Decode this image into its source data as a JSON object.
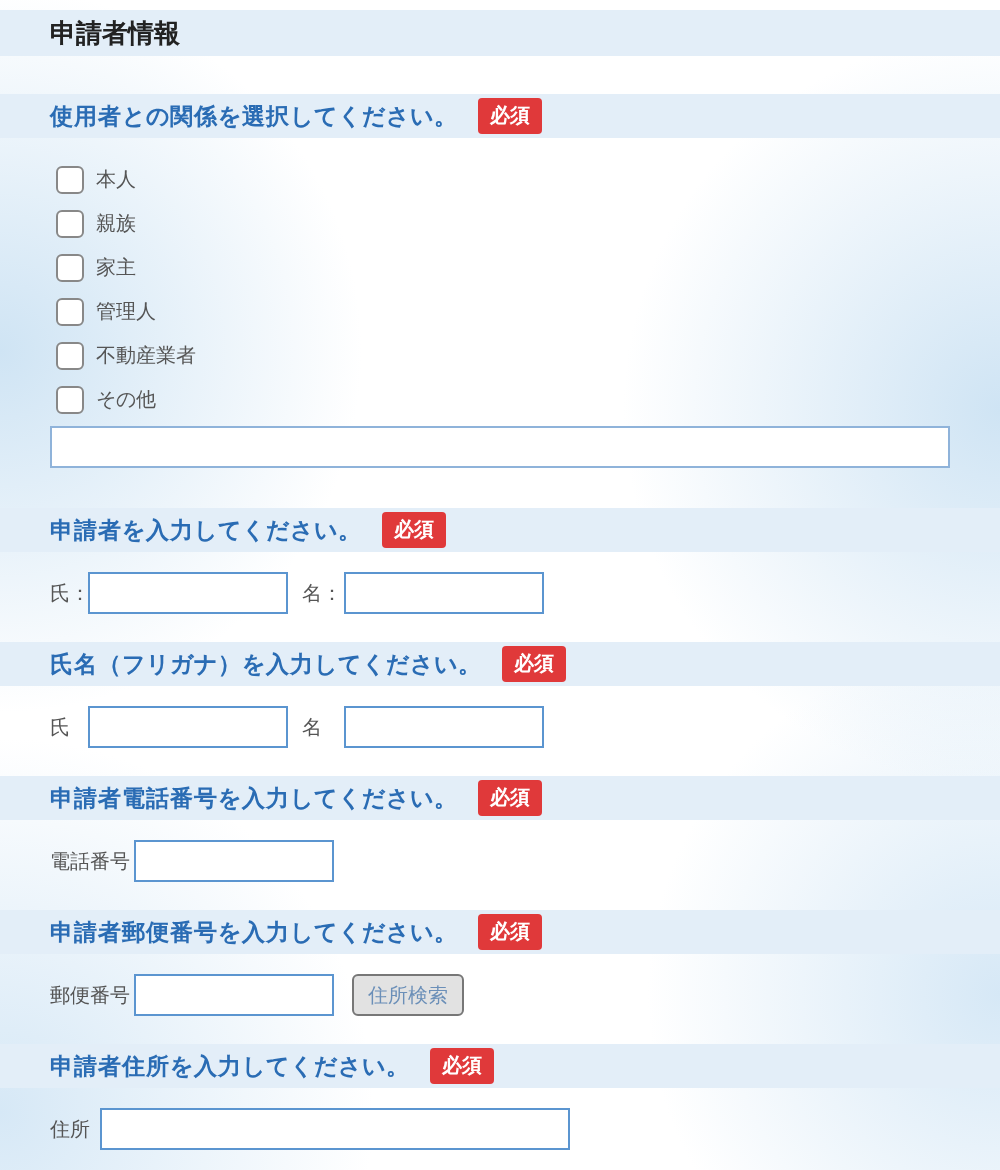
{
  "title": "申請者情報",
  "sections": [
    {
      "kind": "checkboxes",
      "heading": "使用者との関係を選択してください。",
      "required": "必須",
      "options": [
        {
          "label": "本人",
          "checked": false
        },
        {
          "label": "親族",
          "checked": false
        },
        {
          "label": "家主",
          "checked": false
        },
        {
          "label": "管理人",
          "checked": false
        },
        {
          "label": "不動産業者",
          "checked": false
        },
        {
          "label": "その他",
          "checked": false
        }
      ]
    },
    {
      "kind": "pair",
      "heading": "申請者を入力してください。",
      "required": "必須",
      "fields": [
        {
          "label": "氏："
        },
        {
          "label": "名："
        }
      ]
    },
    {
      "kind": "pair",
      "heading": "氏名（フリガナ）を入力してください。",
      "required": "必須",
      "fields": [
        {
          "label": "氏"
        },
        {
          "label": "名"
        }
      ]
    },
    {
      "kind": "single",
      "heading": "申請者電話番号を入力してください。",
      "required": "必須",
      "fields": [
        {
          "label": "電話番号"
        }
      ]
    },
    {
      "kind": "postal",
      "heading": "申請者郵便番号を入力してください。",
      "required": "必須",
      "fields": [
        {
          "label": "郵便番号"
        }
      ],
      "button": "住所検索"
    },
    {
      "kind": "wide",
      "heading": "申請者住所を入力してください。",
      "required": "必須",
      "fields": [
        {
          "label": "住所"
        }
      ]
    }
  ]
}
